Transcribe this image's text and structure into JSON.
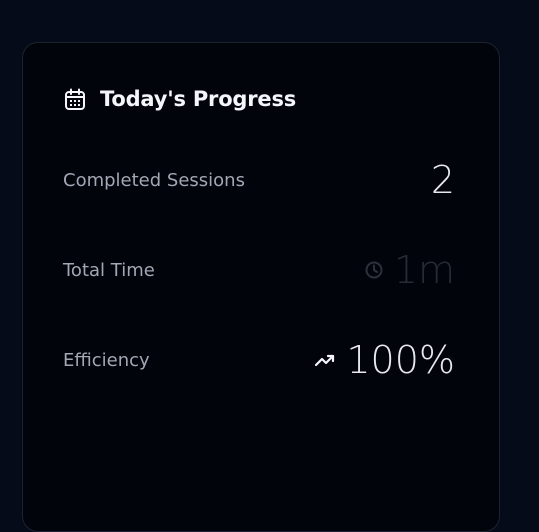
{
  "card": {
    "title": "Today's Progress",
    "title_icon": "calendar-icon"
  },
  "stats": {
    "sessions": {
      "label": "Completed Sessions",
      "value": "2"
    },
    "time": {
      "label": "Total Time",
      "value": "1m",
      "icon": "clock-icon"
    },
    "efficiency": {
      "label": "Efficiency",
      "value": "100%",
      "icon": "trending-up-icon"
    }
  },
  "colors": {
    "background": "#060b1a",
    "card": "#02040b",
    "text": "#e7e9ee",
    "muted_label": "#a2a7b4",
    "muted_value": "#272b35"
  }
}
